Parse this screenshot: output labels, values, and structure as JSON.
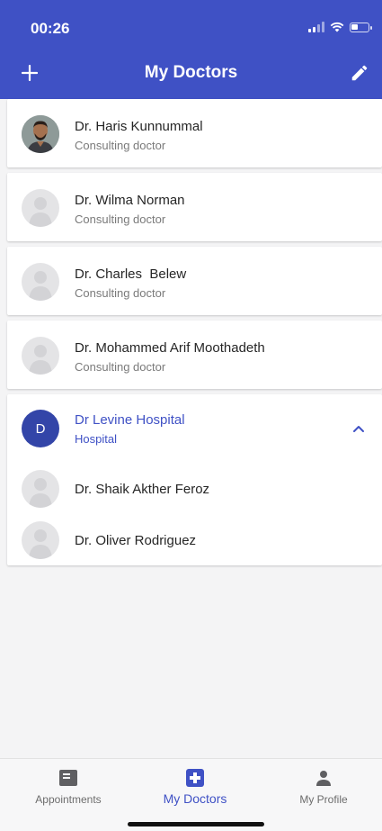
{
  "status_bar": {
    "time": "00:26"
  },
  "header": {
    "title": "My Doctors"
  },
  "doctors": [
    {
      "name": "Dr. Haris Kunnummal",
      "role": "Consulting doctor",
      "avatar": "photo"
    },
    {
      "name": "Dr. Wilma Norman",
      "role": "Consulting doctor",
      "avatar": "placeholder"
    },
    {
      "name": "Dr. Charles  Belew",
      "role": "Consulting doctor",
      "avatar": "placeholder"
    },
    {
      "name": "Dr. Mohammed Arif Moothadeth",
      "role": "Consulting doctor",
      "avatar": "placeholder"
    }
  ],
  "hospital": {
    "initial": "D",
    "name": "Dr Levine Hospital",
    "type": "Hospital",
    "expanded": true,
    "doctors": [
      {
        "name": "Dr. Shaik Akther Feroz"
      },
      {
        "name": "Dr. Oliver Rodriguez"
      }
    ]
  },
  "bottom_nav": {
    "items": [
      {
        "label": "Appointments",
        "icon": "calendar-card-icon",
        "active": false
      },
      {
        "label": "My Doctors",
        "icon": "medical-cross-icon",
        "active": true
      },
      {
        "label": "My Profile",
        "icon": "person-icon",
        "active": false
      }
    ]
  },
  "colors": {
    "primary": "#3f51c5",
    "hospital_avatar": "#3345a8",
    "background": "#f4f4f5",
    "card": "#ffffff",
    "inactive_nav": "#6c6c6c"
  }
}
